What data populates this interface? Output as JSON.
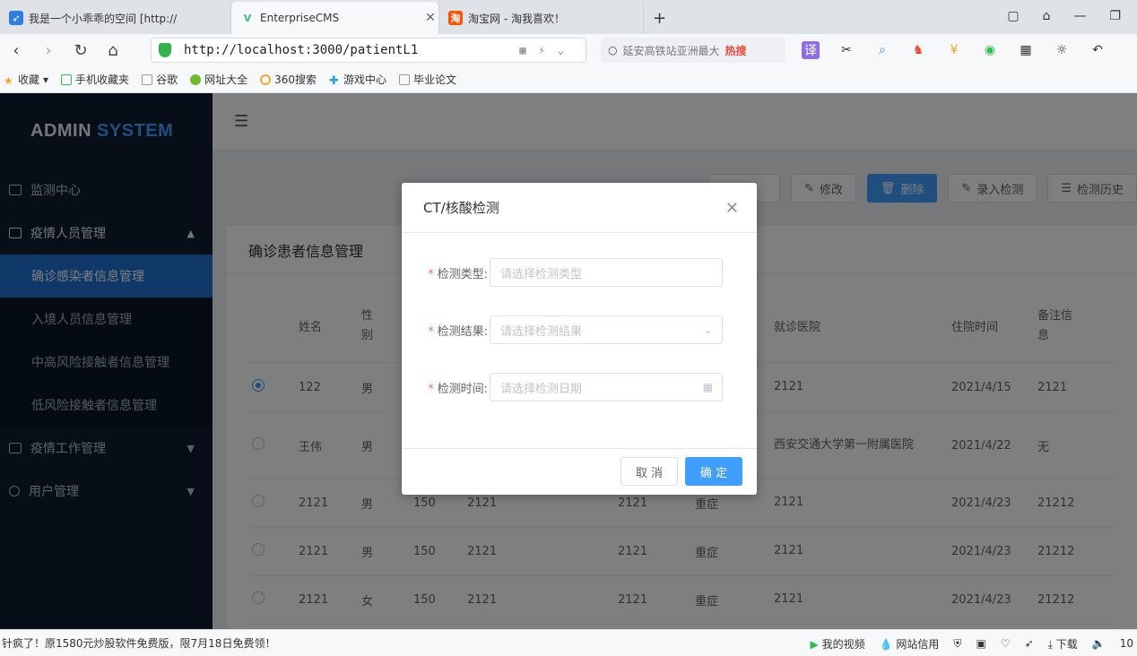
{
  "browser": {
    "tabs": [
      {
        "title": "我是一个小乖乖的空间 [http://",
        "icon": "feather-icon",
        "color": "#2f7de1",
        "active": false
      },
      {
        "title": "EnterpriseCMS",
        "icon": "vue-logo-icon",
        "color": "#42b883",
        "active": true
      },
      {
        "title": "淘宝网 - 淘我喜欢！",
        "icon": "taobao-icon",
        "color": "#ff5000",
        "active": false
      }
    ],
    "new_tab": "+",
    "url": "http://localhost:3000/patientL1",
    "search_placeholder": "延安高铁站亚洲最大",
    "search_hot": "热搜",
    "bookmarks": [
      "收藏",
      "手机收藏夹",
      "谷歌",
      "网址大全",
      "360搜索",
      "游戏中心",
      "毕业论文"
    ]
  },
  "app": {
    "logo_text": "ADMIN",
    "logo_accent": "SYSTEM",
    "menu": [
      {
        "label": "监测中心",
        "type": "item"
      },
      {
        "label": "疫情人员管理",
        "type": "group",
        "expanded": true
      },
      {
        "label": "确诊感染者信息管理",
        "type": "sub",
        "active": true
      },
      {
        "label": "入境人员信息管理",
        "type": "sub"
      },
      {
        "label": "中高风险接触者信息管理",
        "type": "sub"
      },
      {
        "label": "低风险接触者信息管理",
        "type": "sub"
      },
      {
        "label": "疫情工作管理",
        "type": "group"
      },
      {
        "label": "用户管理",
        "type": "group"
      }
    ],
    "toolbar": {
      "edit": "修改",
      "delete": "删除",
      "record": "录入检测",
      "history": "检测历史"
    },
    "panel_title": "确诊患者信息管理",
    "table": {
      "headers": [
        "",
        "姓名",
        "性别",
        "",
        "",
        "",
        "",
        "就诊医院",
        "住院时间",
        "备注信息"
      ],
      "rows": [
        [
          "",
          "122",
          "男",
          "",
          "",
          "",
          "",
          "2121",
          "2021/4/15",
          "2121"
        ],
        [
          "",
          "王伟",
          "男",
          "",
          "",
          "",
          "",
          "西安交通大学第一附属医院",
          "2021/4/22",
          "无"
        ],
        [
          "",
          "2121",
          "男",
          "150",
          "2121",
          "2121",
          "重症",
          "2121",
          "2021/4/23",
          "21212"
        ],
        [
          "",
          "2121",
          "男",
          "150",
          "2121",
          "2121",
          "重症",
          "2121",
          "2021/4/23",
          "21212"
        ],
        [
          "",
          "2121",
          "女",
          "150",
          "2121",
          "2121",
          "重症",
          "2121",
          "2021/4/23",
          "21212"
        ]
      ],
      "selected_row": 0
    }
  },
  "dialog": {
    "title": "CT/核酸检测",
    "required_mark": "*",
    "fields": [
      {
        "label": "检测类型:",
        "placeholder": "请选择检测类型",
        "suffix": ""
      },
      {
        "label": "检测结果:",
        "placeholder": "请选择检测结果",
        "suffix": "⌄"
      },
      {
        "label": "检测时间:",
        "placeholder": "请选择检测日期",
        "suffix": "▦"
      }
    ],
    "cancel": "取 消",
    "confirm": "确 定"
  },
  "statusbar": {
    "left": "针疯了！原1580元炒股软件免费版，限7月18日免费领！",
    "right": [
      "我的视频",
      "网站信用",
      "下载",
      "10"
    ]
  }
}
